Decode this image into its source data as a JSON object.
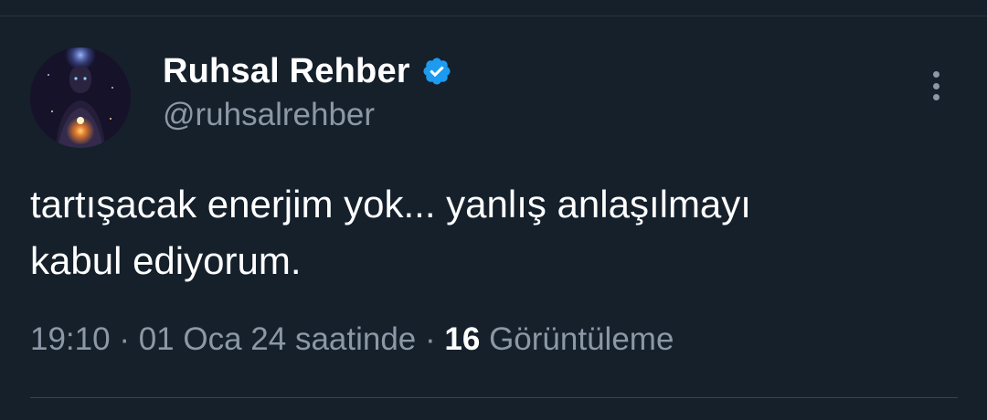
{
  "tweet": {
    "author": {
      "display_name": "Ruhsal Rehber",
      "handle": "@ruhsalrehber",
      "verified": true,
      "avatar_icon": "avatar-glowing-figure"
    },
    "text_line1": "tartışacak enerjim yok... yanlış anlaşılmayı",
    "text_line2": "kabul ediyorum.",
    "time": "19:10",
    "separator": "·",
    "date_text": "01 Oca 24 saatinde",
    "views_count": "16",
    "views_label": "Görüntüleme",
    "more_icon": "more-vertical-icon"
  },
  "colors": {
    "background": "#15202b",
    "text_primary": "#ffffff",
    "text_secondary": "#8b98a5",
    "verified_blue": "#1d9bf0",
    "divider": "#38444d"
  }
}
